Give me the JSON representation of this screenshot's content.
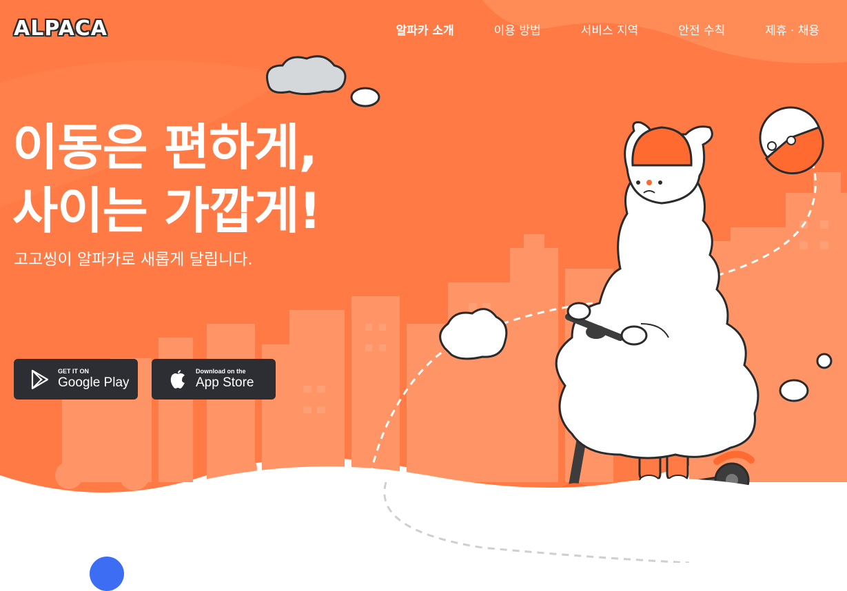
{
  "brand": {
    "logo_text": "ALPACA"
  },
  "nav": {
    "items": [
      {
        "label": "알파카 소개",
        "active": true
      },
      {
        "label": "이용 방법",
        "active": false
      },
      {
        "label": "서비스 지역",
        "active": false
      },
      {
        "label": "안전 수칙",
        "active": false
      },
      {
        "label": "제휴 · 채용",
        "active": false
      }
    ]
  },
  "hero": {
    "headline_line1": "이동은 편하게,",
    "headline_line2": "사이는 가깝게!",
    "subline": "고고씽이 알파카로 새롭게 달립니다."
  },
  "stores": {
    "google": {
      "small": "GET IT ON",
      "big": "Google Play",
      "icon": "google-play-icon"
    },
    "apple": {
      "small": "Download on the",
      "big": "App Store",
      "icon": "apple-icon"
    }
  },
  "colors": {
    "hero_bg": "#ff7a45",
    "hero_dark": "#ff6a30",
    "buildings": "#ff9466",
    "store_button": "#2c2e33",
    "accent_blue": "#3d6df2"
  }
}
